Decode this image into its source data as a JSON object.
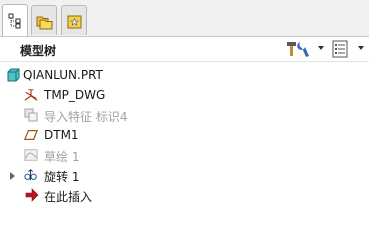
{
  "tabs": [
    {
      "icon": "model-tree-icon",
      "active": true
    },
    {
      "icon": "folder-browser-icon",
      "active": false
    },
    {
      "icon": "favorites-icon",
      "active": false
    }
  ],
  "header": {
    "title": "模型树",
    "settings_icon": "tree-settings-icon",
    "show_icon": "tree-show-icon"
  },
  "tree": {
    "items": [
      {
        "label": "QIANLUN.PRT",
        "icon": "part-icon",
        "dimmed": false
      },
      {
        "label": "TMP_DWG",
        "icon": "coordinate-system-icon",
        "dimmed": false
      },
      {
        "label": "导入特征 标识4",
        "icon": "import-feature-icon",
        "dimmed": true
      },
      {
        "label": "DTM1",
        "icon": "datum-plane-icon",
        "dimmed": false
      },
      {
        "label": "草绘 1",
        "icon": "sketch-icon",
        "dimmed": true
      },
      {
        "label": "旋转 1",
        "icon": "revolve-icon",
        "dimmed": false,
        "expandable": true
      },
      {
        "label": "在此插入",
        "icon": "insert-here-arrow-icon",
        "dimmed": false
      }
    ]
  },
  "colors": {
    "insert_arrow": "#c0141c",
    "datum_plane": "#9b5a19",
    "part_icon": "#4dc3c7",
    "coord_sys": "#a03a1e"
  }
}
